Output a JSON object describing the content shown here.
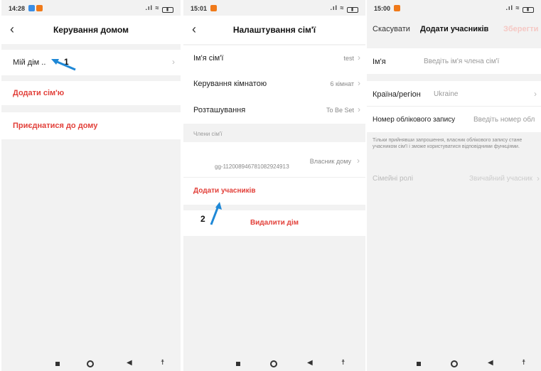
{
  "colors": {
    "accent_red": "#e2403a",
    "arrow_blue": "#1f88d6",
    "background": "#f2f2f2"
  },
  "screen1": {
    "status_time": "14:28",
    "title": "Керування домом",
    "my_home": "Мій дім ..",
    "add_family": "Додати сім'ю",
    "join_home": "Приєднатися до дому",
    "step": "1"
  },
  "screen2": {
    "status_time": "15:01",
    "title": "Налаштування сім'ї",
    "family_name_label": "Ім'я сім'ї",
    "family_name_value": "test",
    "room_mgmt_label": "Керування кімнатою",
    "room_mgmt_value": "6 кімнат",
    "location_label": "Розташування",
    "location_value": "To Be Set",
    "members_section": "Члени сім'ї",
    "member_id": "gg-11200894678108292491З",
    "member_role": "Власник дому",
    "add_members": "Додати учасників",
    "delete_home": "Видалити дім",
    "step": "2"
  },
  "screen3": {
    "status_time": "15:00",
    "cancel": "Скасувати",
    "title": "Додати учасників",
    "save": "Зберегти",
    "name_label": "Ім'я",
    "name_placeholder": "Введіть ім'я члена сім'ї",
    "country_label": "Країна/регіон",
    "country_value": "Ukraine",
    "account_label": "Номер облікового запису",
    "account_placeholder": "Введіть номер обл",
    "note": "Тільки прийнявши запрошення, власник облікового запису стане учасником сім'ї і зможе користуватися відповідними функціями.",
    "roles_label": "Сімейні ролі",
    "roles_value": "Звичайний учасник"
  }
}
